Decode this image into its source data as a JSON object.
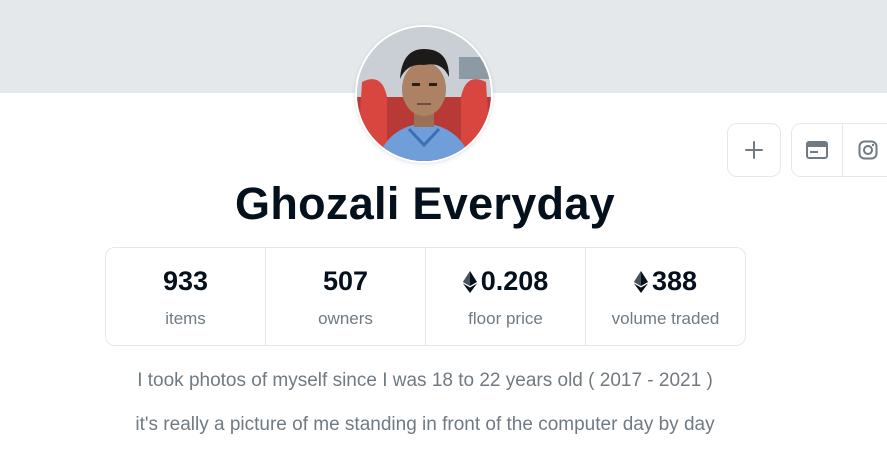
{
  "collection": {
    "name": "Ghozali Everyday"
  },
  "stats": [
    {
      "value": "933",
      "label": "items",
      "eth": false
    },
    {
      "value": "507",
      "label": "owners",
      "eth": false
    },
    {
      "value": "0.208",
      "label": "floor price",
      "eth": true
    },
    {
      "value": "388",
      "label": "volume traded",
      "eth": true
    }
  ],
  "description": {
    "line1": "I took photos of myself since I was 18 to 22 years old ( 2017 - 2021 )",
    "line2": "it's really a picture of me standing in front of the computer day by day"
  },
  "actions": {
    "add_icon": "plus-icon",
    "website_icon": "browser-window-icon",
    "instagram_icon": "instagram-icon"
  },
  "colors": {
    "banner": "#e5e8eb",
    "text_primary": "#04111d",
    "text_secondary": "#707a83",
    "border": "#e5e8eb"
  }
}
